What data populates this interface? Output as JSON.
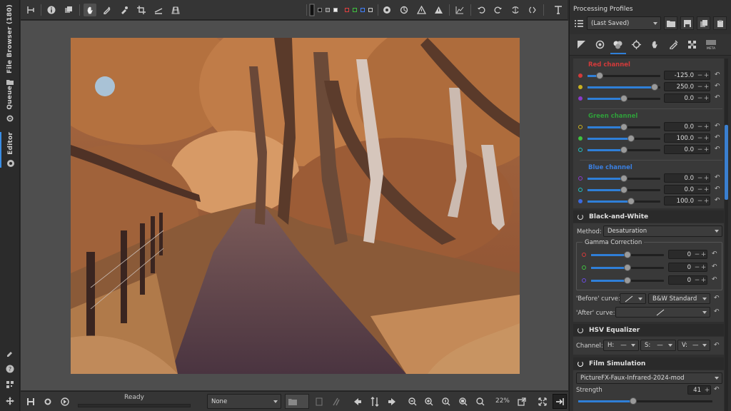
{
  "left_tabs": [
    {
      "label": "File Browser (180)",
      "icon": "folder-icon"
    },
    {
      "label": "Queue",
      "icon": "gears-icon"
    },
    {
      "label": "Editor",
      "icon": "aperture-icon"
    }
  ],
  "bottom_left_icons": [
    "color-picker-icon",
    "help-icon",
    "qr-icon",
    "move-icon"
  ],
  "topbar_icons": [
    "split-icon",
    "info-icon",
    "before-after-icon",
    "hand-icon",
    "eyedropper-icon",
    "color-picker-icon",
    "crop-icon",
    "straighten-icon",
    "perspective-icon",
    "preview-black-icon",
    "bg-black-icon",
    "bg-gray-icon",
    "bg-white-icon",
    "red-channel-icon",
    "green-channel-icon",
    "blue-channel-icon",
    "luminance-icon",
    "focus-mask-icon",
    "circle-icon",
    "warning-shadow-icon",
    "warning-highlight-icon",
    "histogram-icon",
    "rotate-left-icon",
    "rotate-right-icon",
    "flip-h-icon",
    "flip-v-icon",
    "text-tool-icon"
  ],
  "profiles": {
    "title": "Processing Profiles",
    "current": "(Last Saved)"
  },
  "tool_tabs": [
    "exposure-icon",
    "detail-icon",
    "color-icon",
    "advanced-icon",
    "transform-icon",
    "raw-icon",
    "local-icon",
    "meta-icon"
  ],
  "channel_mixer": {
    "red": {
      "title": "Red channel",
      "values": [
        "-125.0",
        "250.0",
        "0.0"
      ],
      "fractions": [
        0.17,
        0.92,
        0.5
      ]
    },
    "green": {
      "title": "Green channel",
      "values": [
        "0.0",
        "100.0",
        "0.0"
      ],
      "fractions": [
        0.5,
        0.6,
        0.5
      ]
    },
    "blue": {
      "title": "Blue channel",
      "values": [
        "0.0",
        "0.0",
        "100.0"
      ],
      "fractions": [
        0.5,
        0.5,
        0.6
      ]
    }
  },
  "black_white": {
    "title": "Black-and-White",
    "method_label": "Method:",
    "method_value": "Desaturation",
    "gamma_title": "Gamma Correction",
    "gamma_values": [
      "0",
      "0",
      "0"
    ],
    "before_curve_label": "'Before' curve:",
    "before_curve_value": "B&W Standard",
    "after_curve_label": "'After' curve:"
  },
  "hsv": {
    "title": "HSV Equalizer",
    "channel_label": "Channel:",
    "h": "H:",
    "s": "S:",
    "v": "V:",
    "dash": "—"
  },
  "film": {
    "title": "Film Simulation",
    "value": "PictureFX-Faux-Infrared-2024-mod",
    "strength_label": "Strength",
    "strength_value": "41",
    "strength_fraction": 0.41
  },
  "bottom": {
    "status": "Ready",
    "combo": "None",
    "zoom": "22%"
  },
  "colors": {
    "accent": "#2f7fd8",
    "red_title": "#d23a3a",
    "green_title": "#2f9e3a",
    "blue_title": "#3a7fe0"
  }
}
